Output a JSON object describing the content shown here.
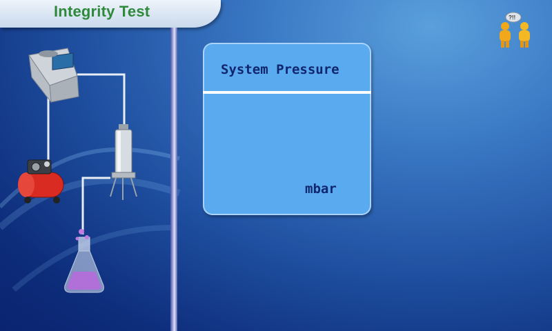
{
  "header": {
    "title": "Integrity Test"
  },
  "panel": {
    "title": "System Pressure",
    "value": "",
    "unit": "mbar"
  },
  "help": {
    "icon": "help-people-icon",
    "bubble_text": "?!!"
  },
  "diagram": {
    "components": [
      "control-unit-icon",
      "air-compressor-icon",
      "filter-housing-icon",
      "flask-icon"
    ]
  },
  "colors": {
    "title_text": "#2e8a3a",
    "panel_bg": "#5aaaf0",
    "panel_text": "#10266e",
    "background_dark": "#0d2c7a",
    "background_light": "#5aa0dc"
  }
}
